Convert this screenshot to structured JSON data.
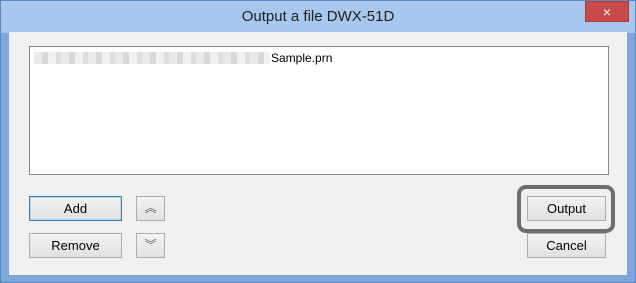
{
  "window": {
    "title": "Output a file DWX-51D",
    "close_glyph": "×"
  },
  "file_list": {
    "items": [
      {
        "filename": "Sample.prn"
      }
    ]
  },
  "buttons": {
    "add_label": "Add",
    "remove_label": "Remove",
    "move_up_icon": "double-chevron-up-icon",
    "move_up_glyph": "︽",
    "move_down_icon": "double-chevron-down-icon",
    "move_down_glyph": "︾",
    "output_label": "Output",
    "cancel_label": "Cancel"
  },
  "colors": {
    "titlebar": "#a8c7ee",
    "window_border": "#7fa6d8",
    "close_button": "#c94a4a",
    "highlight_ring": "#6e6e6e"
  }
}
